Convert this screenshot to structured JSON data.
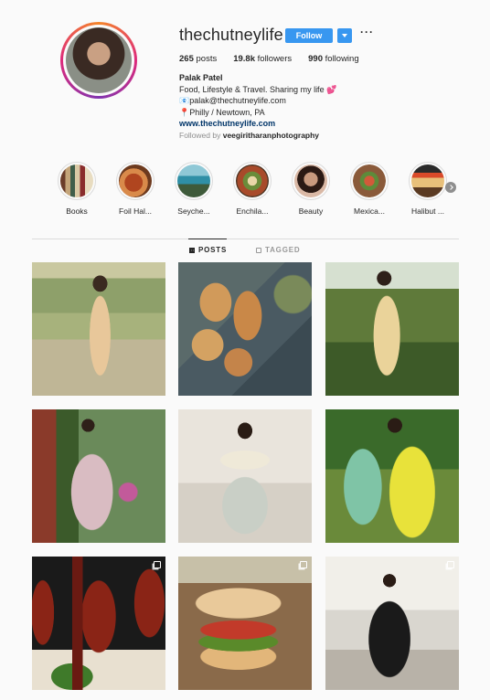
{
  "profile": {
    "username": "thechutneylife",
    "follow_label": "Follow",
    "more_label": "···",
    "stats": {
      "posts_count": "265",
      "posts_label": "posts",
      "followers_count": "19.8k",
      "followers_label": "followers",
      "following_count": "990",
      "following_label": "following"
    },
    "bio": {
      "full_name": "Palak Patel",
      "line1": "Food, Lifestyle & Travel. Sharing my life 💕",
      "line2": "📧palak@thechutneylife.com",
      "line3": "📍Philly / Newtown, PA",
      "website": "www.thechutneylife.com"
    },
    "followed_by_prefix": "Followed by ",
    "followed_by_user": "veegiritharanphotography"
  },
  "highlights": [
    {
      "label": "Books"
    },
    {
      "label": "Foil Hal..."
    },
    {
      "label": "Seyche..."
    },
    {
      "label": "Enchila..."
    },
    {
      "label": "Beauty"
    },
    {
      "label": "Mexica..."
    },
    {
      "label": "Halibut ..."
    }
  ],
  "tabs": {
    "posts": "POSTS",
    "tagged": "TAGGED"
  },
  "colors": {
    "accent": "#3897f0",
    "link": "#003569",
    "muted": "#8e8e8e"
  },
  "icons": {
    "posts_tab": "grid-icon",
    "tagged_tab": "tag-icon",
    "next_highlights": "chevron-right-icon",
    "multi_photo": "carousel-icon"
  }
}
